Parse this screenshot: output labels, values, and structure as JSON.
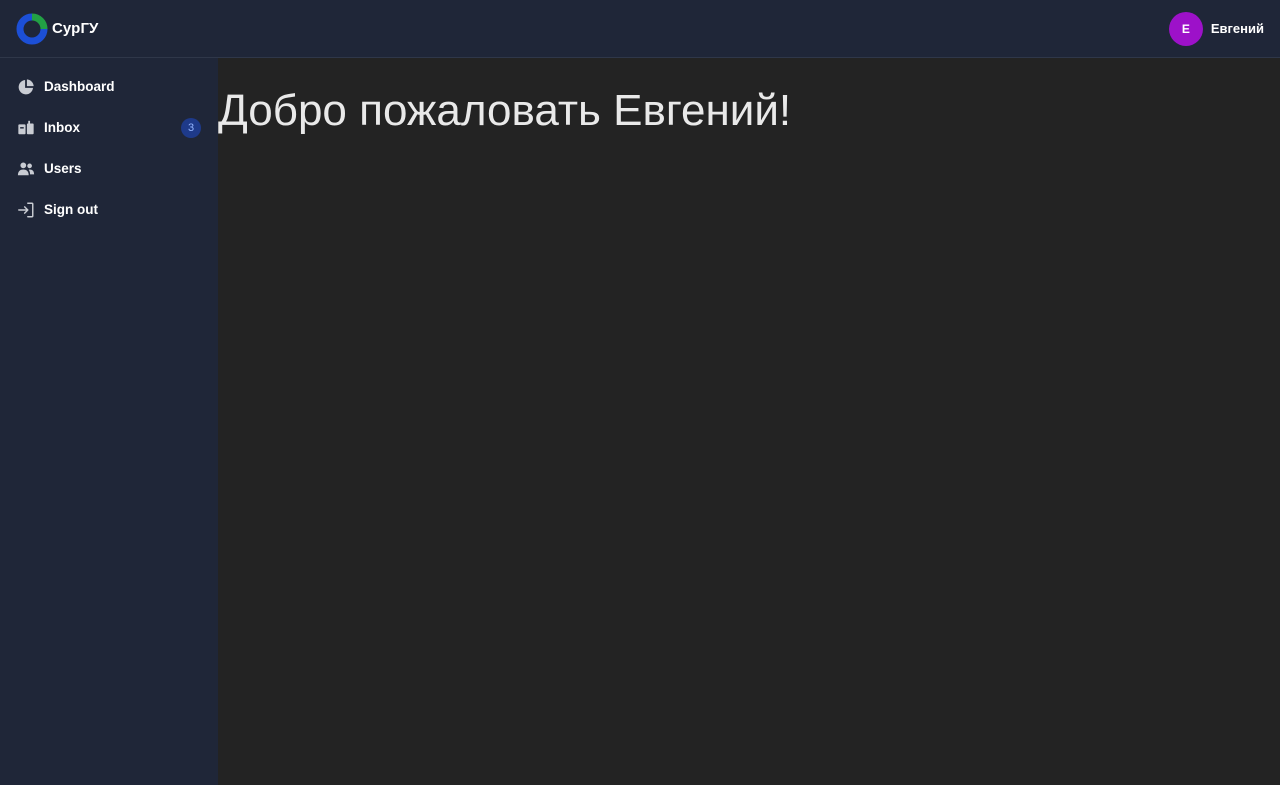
{
  "header": {
    "brand_name": "СурГУ",
    "user": {
      "avatar_letter": "E",
      "name": "Евгений",
      "avatar_color": "#9d11c9"
    }
  },
  "sidebar": {
    "items": [
      {
        "label": "Dashboard",
        "icon": "chart-pie-icon"
      },
      {
        "label": "Inbox",
        "icon": "inbox-icon",
        "badge": "3"
      },
      {
        "label": "Users",
        "icon": "users-icon"
      },
      {
        "label": "Sign out",
        "icon": "sign-out-icon"
      }
    ]
  },
  "main": {
    "welcome_text": "Добро пожаловать Евгений!"
  },
  "colors": {
    "sidebar_bg": "#1f2638",
    "main_bg": "#232323",
    "badge_bg": "#1e3a8a",
    "logo_green": "#22a045",
    "logo_blue": "#1c4fd6"
  }
}
